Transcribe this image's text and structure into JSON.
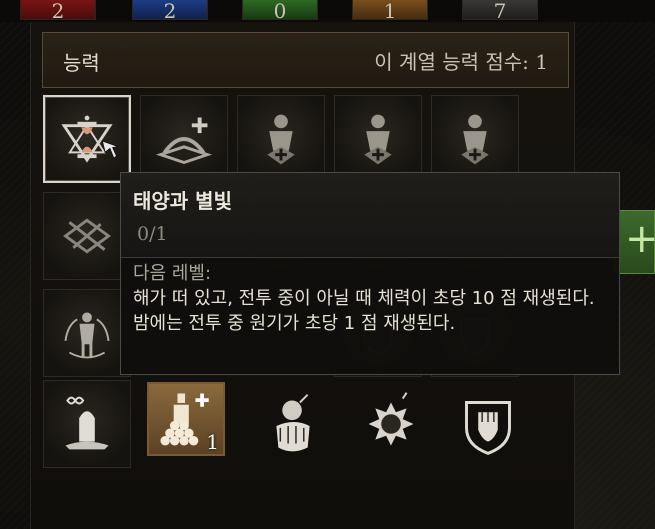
{
  "resources": {
    "red": {
      "value": "2",
      "color": "#8a1a1a"
    },
    "blue": {
      "value": "2",
      "color": "#1e3c86"
    },
    "green": {
      "value": "0",
      "color": "#2e6a22"
    },
    "orange": {
      "value": "1",
      "color": "#7a4e1c"
    },
    "gray": {
      "value": "7",
      "color": "#3a3836"
    }
  },
  "panel": {
    "title": "능력",
    "score_label": "이 계열 능력 점수: 1"
  },
  "skills": {
    "row1": [
      "sun-and-stars-icon",
      "arch-plus-icon",
      "knight-medic-icon",
      "knight-medic-icon",
      "knight-medic-icon"
    ],
    "row2": [
      "crossbow-icon",
      "swords-icon",
      "swords-icon",
      "swords-icon",
      "potion-icon"
    ],
    "row3": [
      "figure-arrows-icon",
      "shield-icon",
      "shield-icon",
      "shield-icon",
      "shield-icon"
    ],
    "row4": [
      "infinity-tombstone-icon",
      "bottle-coins-icon",
      "bomb-hand-icon",
      "bomb-explosion-icon",
      "fist-shield-icon"
    ],
    "bottle_level": "1"
  },
  "tooltip": {
    "title": "태양과 별빛",
    "level": "0/1",
    "next_label": "다음 레벨:",
    "description": "해가 떠 있고, 전투 중이 아닐 때 체력이 초당 10 점 재생된다. 밤에는 전투 중 원기가 초당 1 점 재생된다."
  },
  "side_button": {
    "label": "+"
  },
  "accent_color": "#5a4a33"
}
